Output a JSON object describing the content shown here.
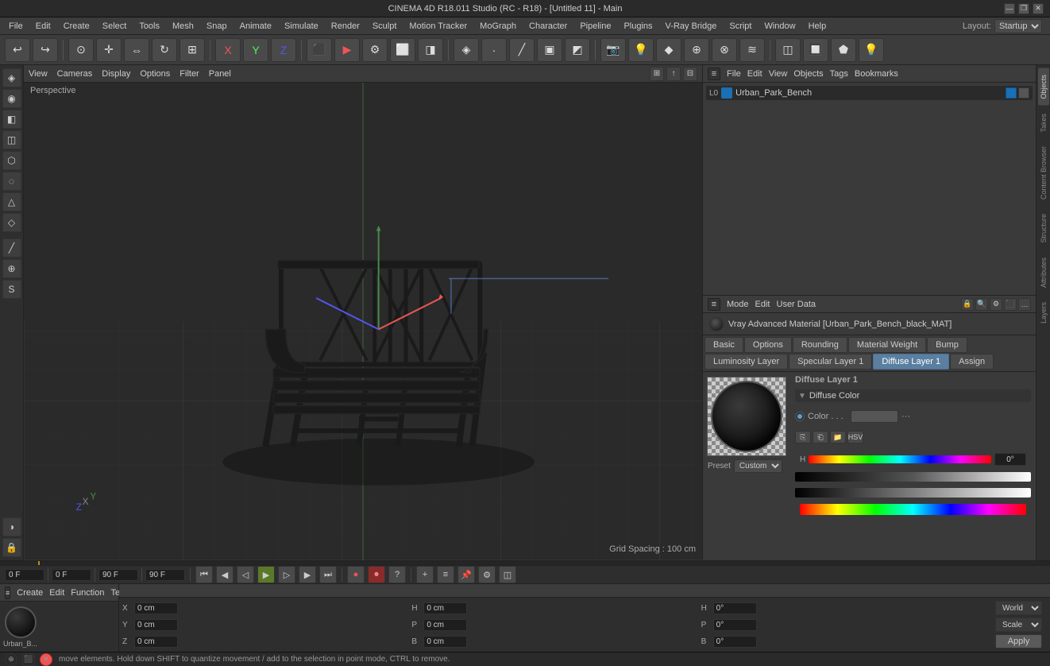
{
  "app": {
    "title": "CINEMA 4D R18.011 Studio (RC - R18) - [Untitled 11] - Main"
  },
  "titlebar": {
    "title": "CINEMA 4D R18.011 Studio (RC - R18) - [Untitled 11] - Main",
    "controls": [
      "—",
      "❐",
      "✕"
    ]
  },
  "menubar": {
    "items": [
      "File",
      "Edit",
      "Objects",
      "Tags",
      "Bookmarks"
    ]
  },
  "topmenubar": {
    "items": [
      "File",
      "Edit",
      "Create",
      "Select",
      "Tools",
      "Mesh",
      "Snap",
      "Animate",
      "Simulate",
      "Render",
      "Sculpt",
      "Motion Tracker",
      "MoGraph",
      "Character",
      "Pipeline",
      "Plugins",
      "V-Ray Bridge",
      "Script",
      "Window",
      "Help"
    ]
  },
  "layout": {
    "label": "Layout:",
    "value": "Startup"
  },
  "viewport": {
    "mode_label": "Perspective",
    "grid_spacing": "Grid Spacing : 100 cm",
    "menus": [
      "View",
      "Cameras",
      "Display",
      "Options",
      "Filter",
      "Panel"
    ]
  },
  "object_manager": {
    "menus": [
      "File",
      "Edit",
      "View",
      "Objects",
      "Tags",
      "Bookmarks"
    ],
    "object": {
      "name": "Urban_Park_Bench",
      "color": "#1a6fb5",
      "layer_num": "0"
    }
  },
  "attr_panel": {
    "menus": [
      "Mode",
      "Edit",
      "User Data"
    ],
    "material_name": "Vray Advanced Material [Urban_Park_Bench_black_MAT]",
    "tabs": {
      "basic": "Basic",
      "options": "Options",
      "rounding": "Rounding",
      "material_weight": "Material Weight",
      "bump": "Bump",
      "luminosity_layer": "Luminosity Layer",
      "specular_layer": "Specular Layer 1",
      "diffuse_layer": "Diffuse Layer 1",
      "assign": "Assign"
    },
    "active_tab": "Diffuse Layer 1",
    "preset": {
      "label": "Preset",
      "value": "Custom"
    },
    "diffuse_layer": {
      "title": "Diffuse Layer 1",
      "section": "Diffuse Color",
      "color_label": "Color . . .",
      "color_value": "#555555"
    }
  },
  "right_tabs": [
    "Objects",
    "Takes",
    "Content Browser",
    "Structure",
    "Attributes",
    "Layers"
  ],
  "coord_panel": {
    "menus": [
      "Create",
      "Edit",
      "Function",
      "Texture"
    ],
    "fields": {
      "x_pos": "0 cm",
      "y_pos": "0 cm",
      "z_pos": "0 cm",
      "x_rot": "0°",
      "y_rot": "0°",
      "z_rot": "0°",
      "h_size": "0 cm",
      "p_size": "0 cm",
      "b_size": "0 cm"
    },
    "dropdown_world": "World",
    "dropdown_scale": "Scale",
    "apply_btn": "Apply"
  },
  "timeline": {
    "current_frame": "0 F",
    "start_frame": "0 F",
    "end_frame": "90 F",
    "max_frame": "90 F",
    "keyframe_field": "0 F"
  },
  "status_bar": {
    "text": "move elements. Hold down SHIFT to quantize movement / add to the selection in point mode, CTRL to remove."
  },
  "icons": {
    "undo": "↩",
    "redo": "↪",
    "move": "✛",
    "x_axis": "X",
    "y_axis": "Y",
    "z_axis": "Z",
    "play": "▶",
    "stop": "◼",
    "prev": "◀",
    "next": "▶",
    "record": "●",
    "rewind": "⏮",
    "fastforward": "⏭"
  }
}
